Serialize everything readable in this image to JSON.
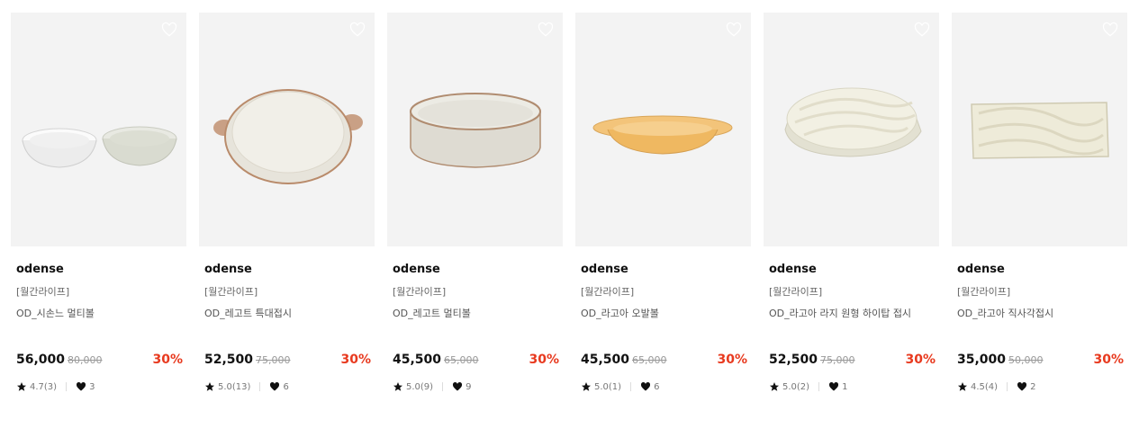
{
  "colors": {
    "accent": "#e83a1f",
    "thumb_bg": "#f3f3f3"
  },
  "icons": {
    "wishlist": "heart-outline-icon",
    "rating": "star-icon",
    "likes": "heart-filled-icon"
  },
  "products": [
    {
      "brand": "odense",
      "tag": "[월간라이프]",
      "title": "OD_시손느 멀티볼",
      "price": "56,000",
      "original_price": "80,000",
      "discount": "30%",
      "rating": "4.7(3)",
      "likes": "3",
      "art": "two-bowls"
    },
    {
      "brand": "odense",
      "tag": "[월간라이프]",
      "title": "OD_레고트 특대접시",
      "price": "52,500",
      "original_price": "75,000",
      "discount": "30%",
      "rating": "5.0(13)",
      "likes": "6",
      "art": "handled-plate"
    },
    {
      "brand": "odense",
      "tag": "[월간라이프]",
      "title": "OD_레고트 멀티볼",
      "price": "45,500",
      "original_price": "65,000",
      "discount": "30%",
      "rating": "5.0(9)",
      "likes": "9",
      "art": "deep-bowl"
    },
    {
      "brand": "odense",
      "tag": "[월간라이프]",
      "title": "OD_라고아 오발볼",
      "price": "45,500",
      "original_price": "65,000",
      "discount": "30%",
      "rating": "5.0(1)",
      "likes": "6",
      "art": "oval-bowl"
    },
    {
      "brand": "odense",
      "tag": "[월간라이프]",
      "title": "OD_라고아 라지 원형 하이탑 접시",
      "price": "52,500",
      "original_price": "75,000",
      "discount": "30%",
      "rating": "5.0(2)",
      "likes": "1",
      "art": "round-wave-plate"
    },
    {
      "brand": "odense",
      "tag": "[월간라이프]",
      "title": "OD_라고아 직사각접시",
      "price": "35,000",
      "original_price": "50,000",
      "discount": "30%",
      "rating": "4.5(4)",
      "likes": "2",
      "art": "rect-plate"
    }
  ]
}
